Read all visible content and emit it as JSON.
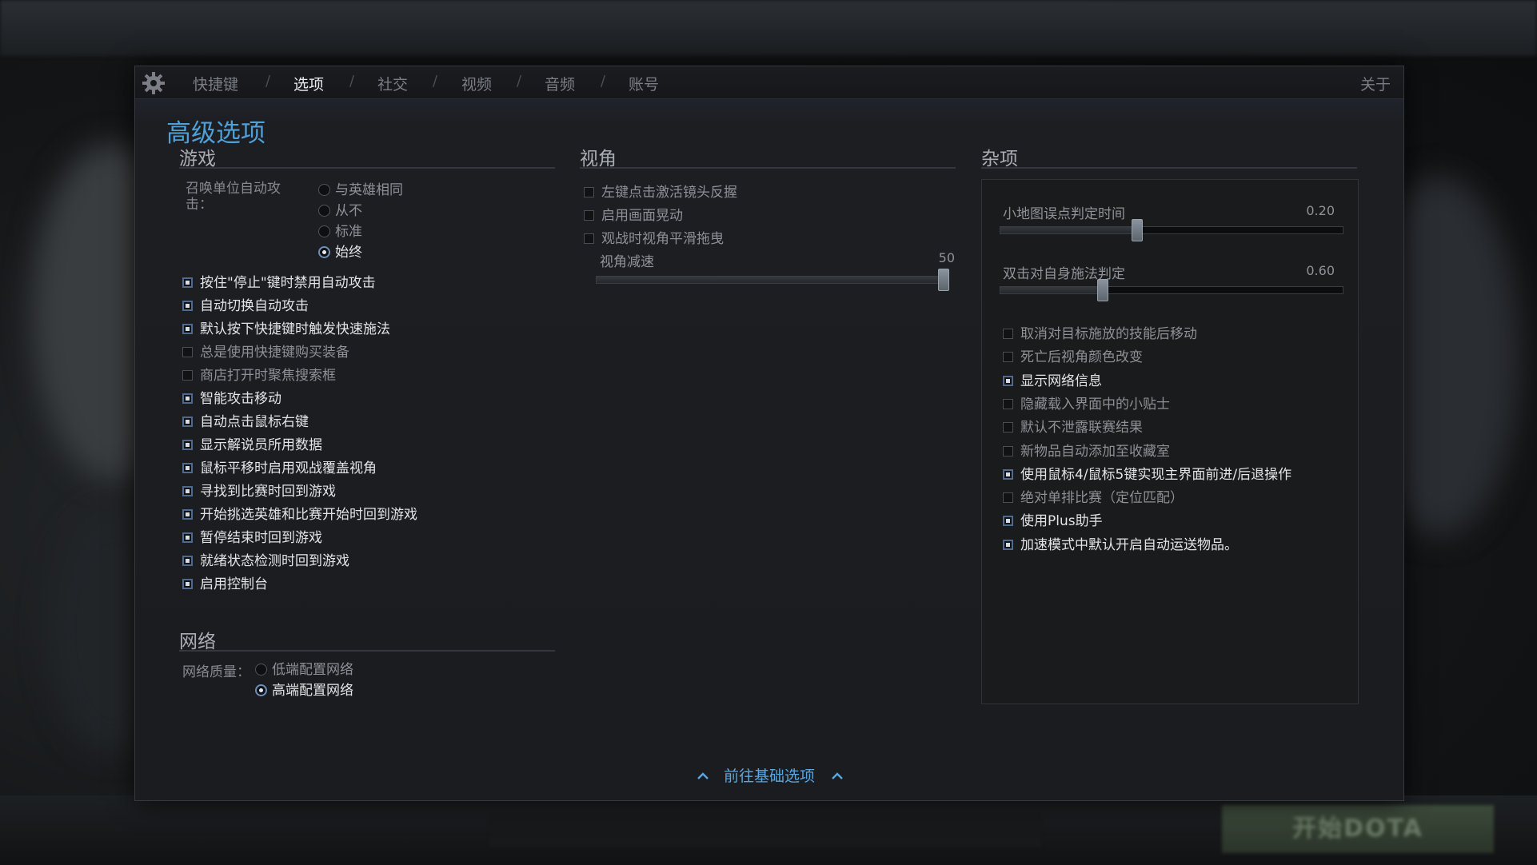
{
  "tabs": {
    "items": [
      "快捷键",
      "选项",
      "社交",
      "视频",
      "音频",
      "账号"
    ],
    "active": "选项",
    "separator": "/",
    "about": "关于"
  },
  "page_title": "高级选项",
  "game": {
    "heading": "游戏",
    "summon_label": "召唤单位自动攻击：",
    "summon_options": [
      {
        "label": "与英雄相同",
        "selected": false
      },
      {
        "label": "从不",
        "selected": false
      },
      {
        "label": "标准",
        "selected": false
      },
      {
        "label": "始终",
        "selected": true
      }
    ],
    "checkboxes": [
      {
        "label": "按住\"停止\"键时禁用自动攻击",
        "checked": true
      },
      {
        "label": "自动切换自动攻击",
        "checked": true
      },
      {
        "label": "默认按下快捷键时触发快速施法",
        "checked": true
      },
      {
        "label": "总是使用快捷键购买装备",
        "checked": false
      },
      {
        "label": "商店打开时聚焦搜索框",
        "checked": false
      },
      {
        "label": "智能攻击移动",
        "checked": true
      },
      {
        "label": "自动点击鼠标右键",
        "checked": true
      },
      {
        "label": "显示解说员所用数据",
        "checked": true
      },
      {
        "label": "鼠标平移时启用观战覆盖视角",
        "checked": true
      },
      {
        "label": "寻找到比赛时回到游戏",
        "checked": true
      },
      {
        "label": "开始挑选英雄和比赛开始时回到游戏",
        "checked": true
      },
      {
        "label": "暂停结束时回到游戏",
        "checked": true
      },
      {
        "label": "就绪状态检测时回到游戏",
        "checked": true
      },
      {
        "label": "启用控制台",
        "checked": true
      }
    ]
  },
  "network": {
    "heading": "网络",
    "quality_label": "网络质量：",
    "options": [
      {
        "label": "低端配置网络",
        "selected": false
      },
      {
        "label": "高端配置网络",
        "selected": true
      }
    ]
  },
  "camera": {
    "heading": "视角",
    "checkboxes": [
      {
        "label": "左键点击激活镜头反握",
        "checked": false
      },
      {
        "label": "启用画面晃动",
        "checked": false
      },
      {
        "label": "观战时视角平滑拖曳",
        "checked": false
      }
    ],
    "slider": {
      "label": "视角减速",
      "value": "50",
      "fraction": 1.0
    }
  },
  "misc": {
    "heading": "杂项",
    "sliders": [
      {
        "label": "小地图误点判定时间",
        "value": "0.20",
        "fraction": 0.4
      },
      {
        "label": "双击对自身施法判定",
        "value": "0.60",
        "fraction": 0.3
      }
    ],
    "checkboxes": [
      {
        "label": "取消对目标施放的技能后移动",
        "checked": false
      },
      {
        "label": "死亡后视角颜色改变",
        "checked": false
      },
      {
        "label": "显示网络信息",
        "checked": true
      },
      {
        "label": "隐藏载入界面中的小贴士",
        "checked": false
      },
      {
        "label": "默认不泄露联赛结果",
        "checked": false
      },
      {
        "label": "新物品自动添加至收藏室",
        "checked": false
      },
      {
        "label": "使用鼠标4/鼠标5键实现主界面前进/后退操作",
        "checked": true
      },
      {
        "label": "绝对单排比赛（定位匹配）",
        "checked": false
      },
      {
        "label": "使用Plus助手",
        "checked": true
      },
      {
        "label": "加速模式中默认开启自动运送物品。",
        "checked": true
      }
    ]
  },
  "goto_basic": "前往基础选项",
  "play_button": "开始DOTA",
  "colors": {
    "accent": "#4f9fd8",
    "panel": "#1b1c1f",
    "checkbox_on": "#4e6a8f"
  }
}
